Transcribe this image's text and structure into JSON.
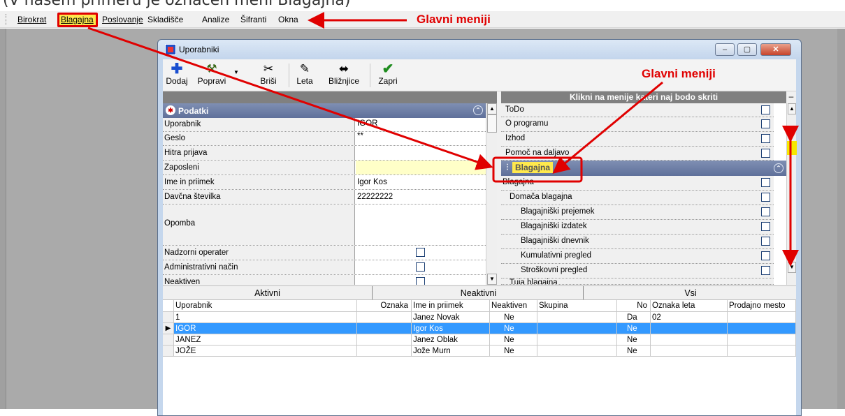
{
  "caption": "(V našem primeru je označen meni Blagajna)",
  "menubar": [
    "Birokrat",
    "Blagajna",
    "Poslovanje",
    "Skladišče",
    "Analize",
    "Šifranti",
    "Okna"
  ],
  "annotations": {
    "top_label": "Glavni meniji",
    "right_label": "Glavni meniji"
  },
  "window": {
    "title": "Uporabniki",
    "buttons": {
      "minimize": "–",
      "maximize": "▢",
      "close": "✕"
    }
  },
  "toolbar": {
    "dodaj": "Dodaj",
    "popravi": "Popravi",
    "brisi": "Briši",
    "leta": "Leta",
    "bliznjice": "Bližnjice",
    "zapri": "Zapri"
  },
  "properties": {
    "category": "Podatki",
    "rows": [
      {
        "label": "Uporabnik",
        "value": "IGOR"
      },
      {
        "label": "Geslo",
        "value": "**"
      },
      {
        "label": "Hitra prijava",
        "value": ""
      },
      {
        "label": "Zaposleni",
        "value": ""
      },
      {
        "label": "Ime in priimek",
        "value": "Igor Kos"
      },
      {
        "label": "Davčna številka",
        "value": "22222222"
      },
      {
        "label": "Opomba",
        "value": ""
      },
      {
        "label": "Nadzorni operater",
        "value": ""
      },
      {
        "label": "Administrativni način",
        "value": ""
      },
      {
        "label": "Neaktiven",
        "value": ""
      }
    ]
  },
  "menu_panel": {
    "header": "Klikni na menije kateri naj bodo skriti",
    "items_top": [
      "ToDo",
      "O programu",
      "Izhod",
      "Pomoč na daljavo"
    ],
    "category": "Blagajna",
    "items": [
      {
        "label": "Blagajna",
        "indent": 0
      },
      {
        "label": "Domača blagajna",
        "indent": 1
      },
      {
        "label": "Blagajniški prejemek",
        "indent": 2
      },
      {
        "label": "Blagajniški izdatek",
        "indent": 2
      },
      {
        "label": "Blagajniški dnevnik",
        "indent": 2
      },
      {
        "label": "Kumulativni pregled",
        "indent": 2
      },
      {
        "label": "Stroškovni pregled",
        "indent": 2
      },
      {
        "label": "Tujа blagajna",
        "indent": 1
      }
    ]
  },
  "tabs": [
    "Aktivni",
    "Neaktivni",
    "Vsi"
  ],
  "table": {
    "columns": [
      "Uporabnik",
      "Oznaka",
      "Ime in priimek",
      "Neaktiven",
      "Skupina",
      "No",
      "Oznaka leta",
      "Prodajno mesto"
    ],
    "rows": [
      [
        "1",
        "",
        "Janez Novak",
        "Ne",
        "",
        "Da",
        "02",
        ""
      ],
      [
        "IGOR",
        "",
        "Igor Kos",
        "Ne",
        "",
        "Ne",
        "",
        ""
      ],
      [
        "JANEZ",
        "",
        "Janez Oblak",
        "Ne",
        "",
        "Ne",
        "",
        ""
      ],
      [
        "JOŽE",
        "",
        "Jože Murn",
        "Ne",
        "",
        "Ne",
        "",
        ""
      ]
    ],
    "selected_row": 1
  }
}
